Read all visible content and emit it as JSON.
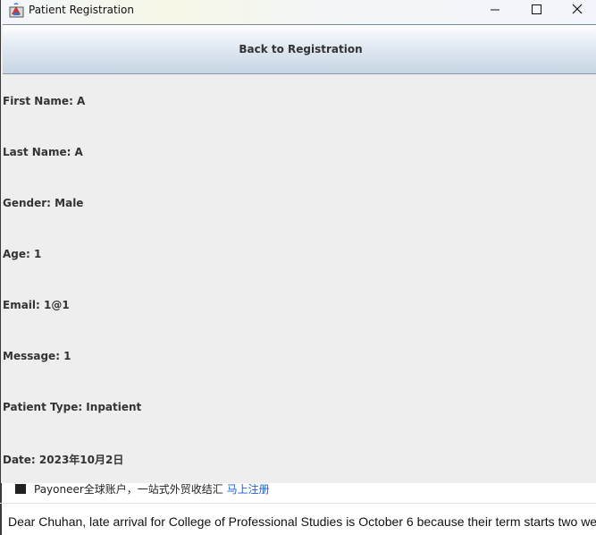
{
  "window": {
    "title": "Patient Registration",
    "back_button_label": "Back to Registration"
  },
  "fields": {
    "first_name": "First Name: A",
    "last_name": "Last Name: A",
    "gender": "Gender: Male",
    "age": "Age: 1",
    "email": "Email: 1@1",
    "message": "Message: 1",
    "patient_type": "Patient Type: Inpatient",
    "date": "Date: 2023年10月2日"
  },
  "background": {
    "ad_text": "Payoneer全球账户，一站式外贸收结汇",
    "ad_link": "马上注册",
    "email_preview": "Dear Chuhan, late arrival for College of Professional Studies is October 6 because their term starts two we"
  }
}
